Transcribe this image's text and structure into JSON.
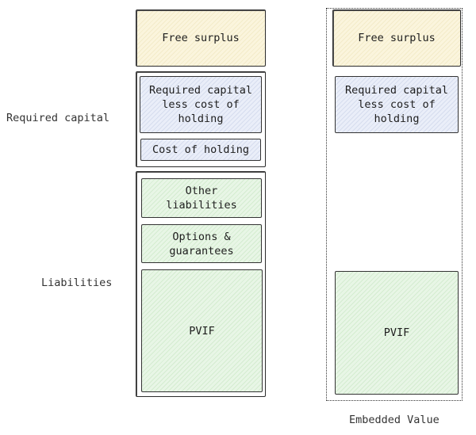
{
  "left_column": {
    "free_surplus": "Free surplus",
    "required_capital_less_cost": "Required capital less cost of holding",
    "cost_of_holding": "Cost of holding",
    "other_liabilities": "Other liabilities",
    "options_guarantees": "Options & guarantees",
    "pvif": "PVIF"
  },
  "right_column": {
    "free_surplus": "Free surplus",
    "required_capital_less_cost": "Required capital less cost of holding",
    "pvif": "PVIF"
  },
  "labels": {
    "required_capital": "Required capital",
    "liabilities": "Liabilities",
    "embedded_value": "Embedded Value"
  },
  "colors": {
    "free_surplus": "#fbf5dd",
    "required_capital": "#eaeef9",
    "liabilities": "#e8f6e6"
  }
}
